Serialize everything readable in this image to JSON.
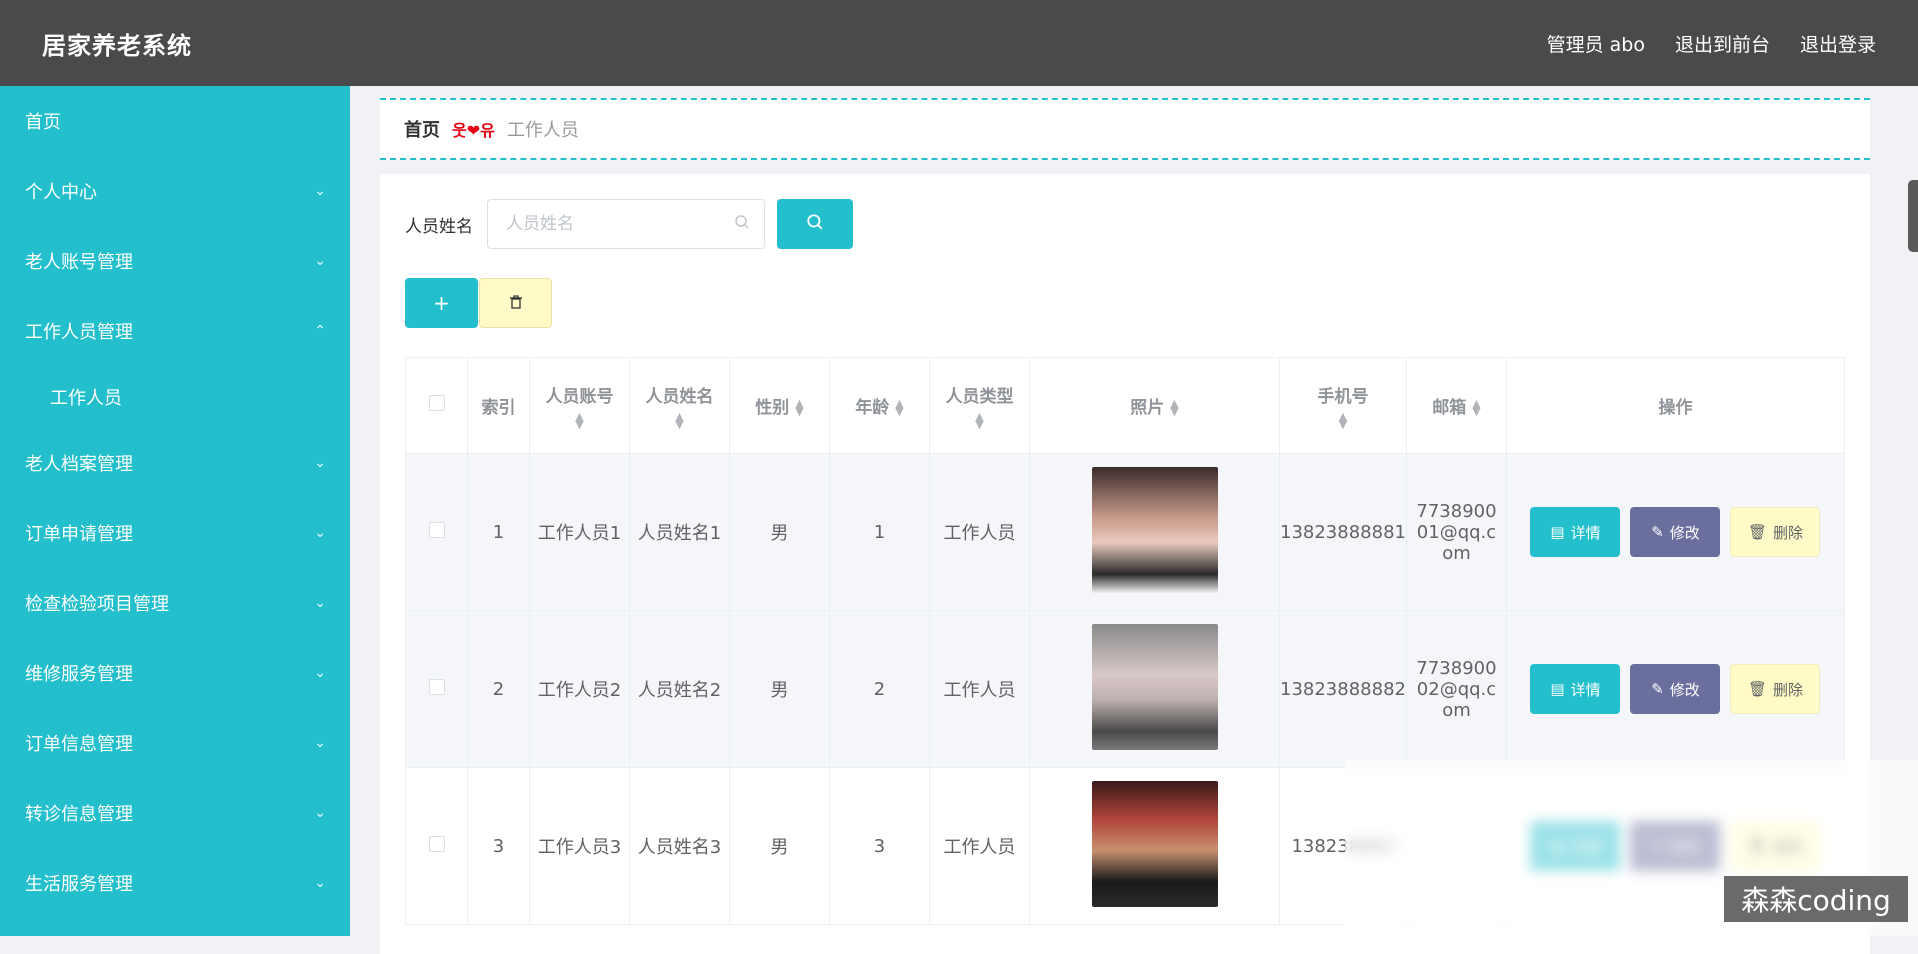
{
  "header": {
    "app_title": "居家养老系统",
    "links": [
      "管理员 abo",
      "退出到前台",
      "退出登录"
    ]
  },
  "sidebar": {
    "items": [
      {
        "label": "首页",
        "expandable": false
      },
      {
        "label": "个人中心",
        "expandable": true,
        "expanded": false
      },
      {
        "label": "老人账号管理",
        "expandable": true,
        "expanded": false
      },
      {
        "label": "工作人员管理",
        "expandable": true,
        "expanded": true
      },
      {
        "label": "工作人员",
        "sub": true
      },
      {
        "label": "老人档案管理",
        "expandable": true,
        "expanded": false
      },
      {
        "label": "订单申请管理",
        "expandable": true,
        "expanded": false
      },
      {
        "label": "检查检验项目管理",
        "expandable": true,
        "expanded": false
      },
      {
        "label": "维修服务管理",
        "expandable": true,
        "expanded": false
      },
      {
        "label": "订单信息管理",
        "expandable": true,
        "expanded": false
      },
      {
        "label": "转诊信息管理",
        "expandable": true,
        "expanded": false
      },
      {
        "label": "生活服务管理",
        "expandable": true,
        "expanded": false
      }
    ]
  },
  "breadcrumb": {
    "home": "首页",
    "separator": "웃❤유",
    "current": "工作人员"
  },
  "search": {
    "label": "人员姓名",
    "placeholder": "人员姓名",
    "value": ""
  },
  "table": {
    "headers": [
      "索引",
      "人员账号",
      "人员姓名",
      "性别",
      "年龄",
      "人员类型",
      "照片",
      "手机号",
      "邮箱",
      "操作"
    ],
    "rows": [
      {
        "index": "1",
        "account": "工作人员1",
        "name": "人员姓名1",
        "gender": "男",
        "age": "1",
        "type": "工作人员",
        "phone": "13823888881",
        "email": "773890001@qq.com"
      },
      {
        "index": "2",
        "account": "工作人员2",
        "name": "人员姓名2",
        "gender": "男",
        "age": "2",
        "type": "工作人员",
        "phone": "13823888882",
        "email": "773890002@qq.com"
      },
      {
        "index": "3",
        "account": "工作人员3",
        "name": "人员姓名3",
        "gender": "男",
        "age": "3",
        "type": "工作人员",
        "phone": "138238883",
        "email": ""
      }
    ],
    "actions": {
      "detail": "详情",
      "edit": "修改",
      "delete": "删除"
    }
  },
  "watermark": "森森coding",
  "colors": {
    "accent": "#24bfcc",
    "edit": "#6a6f9e",
    "delete_bg": "#fffbc6",
    "topbar": "#4a4a4a"
  }
}
